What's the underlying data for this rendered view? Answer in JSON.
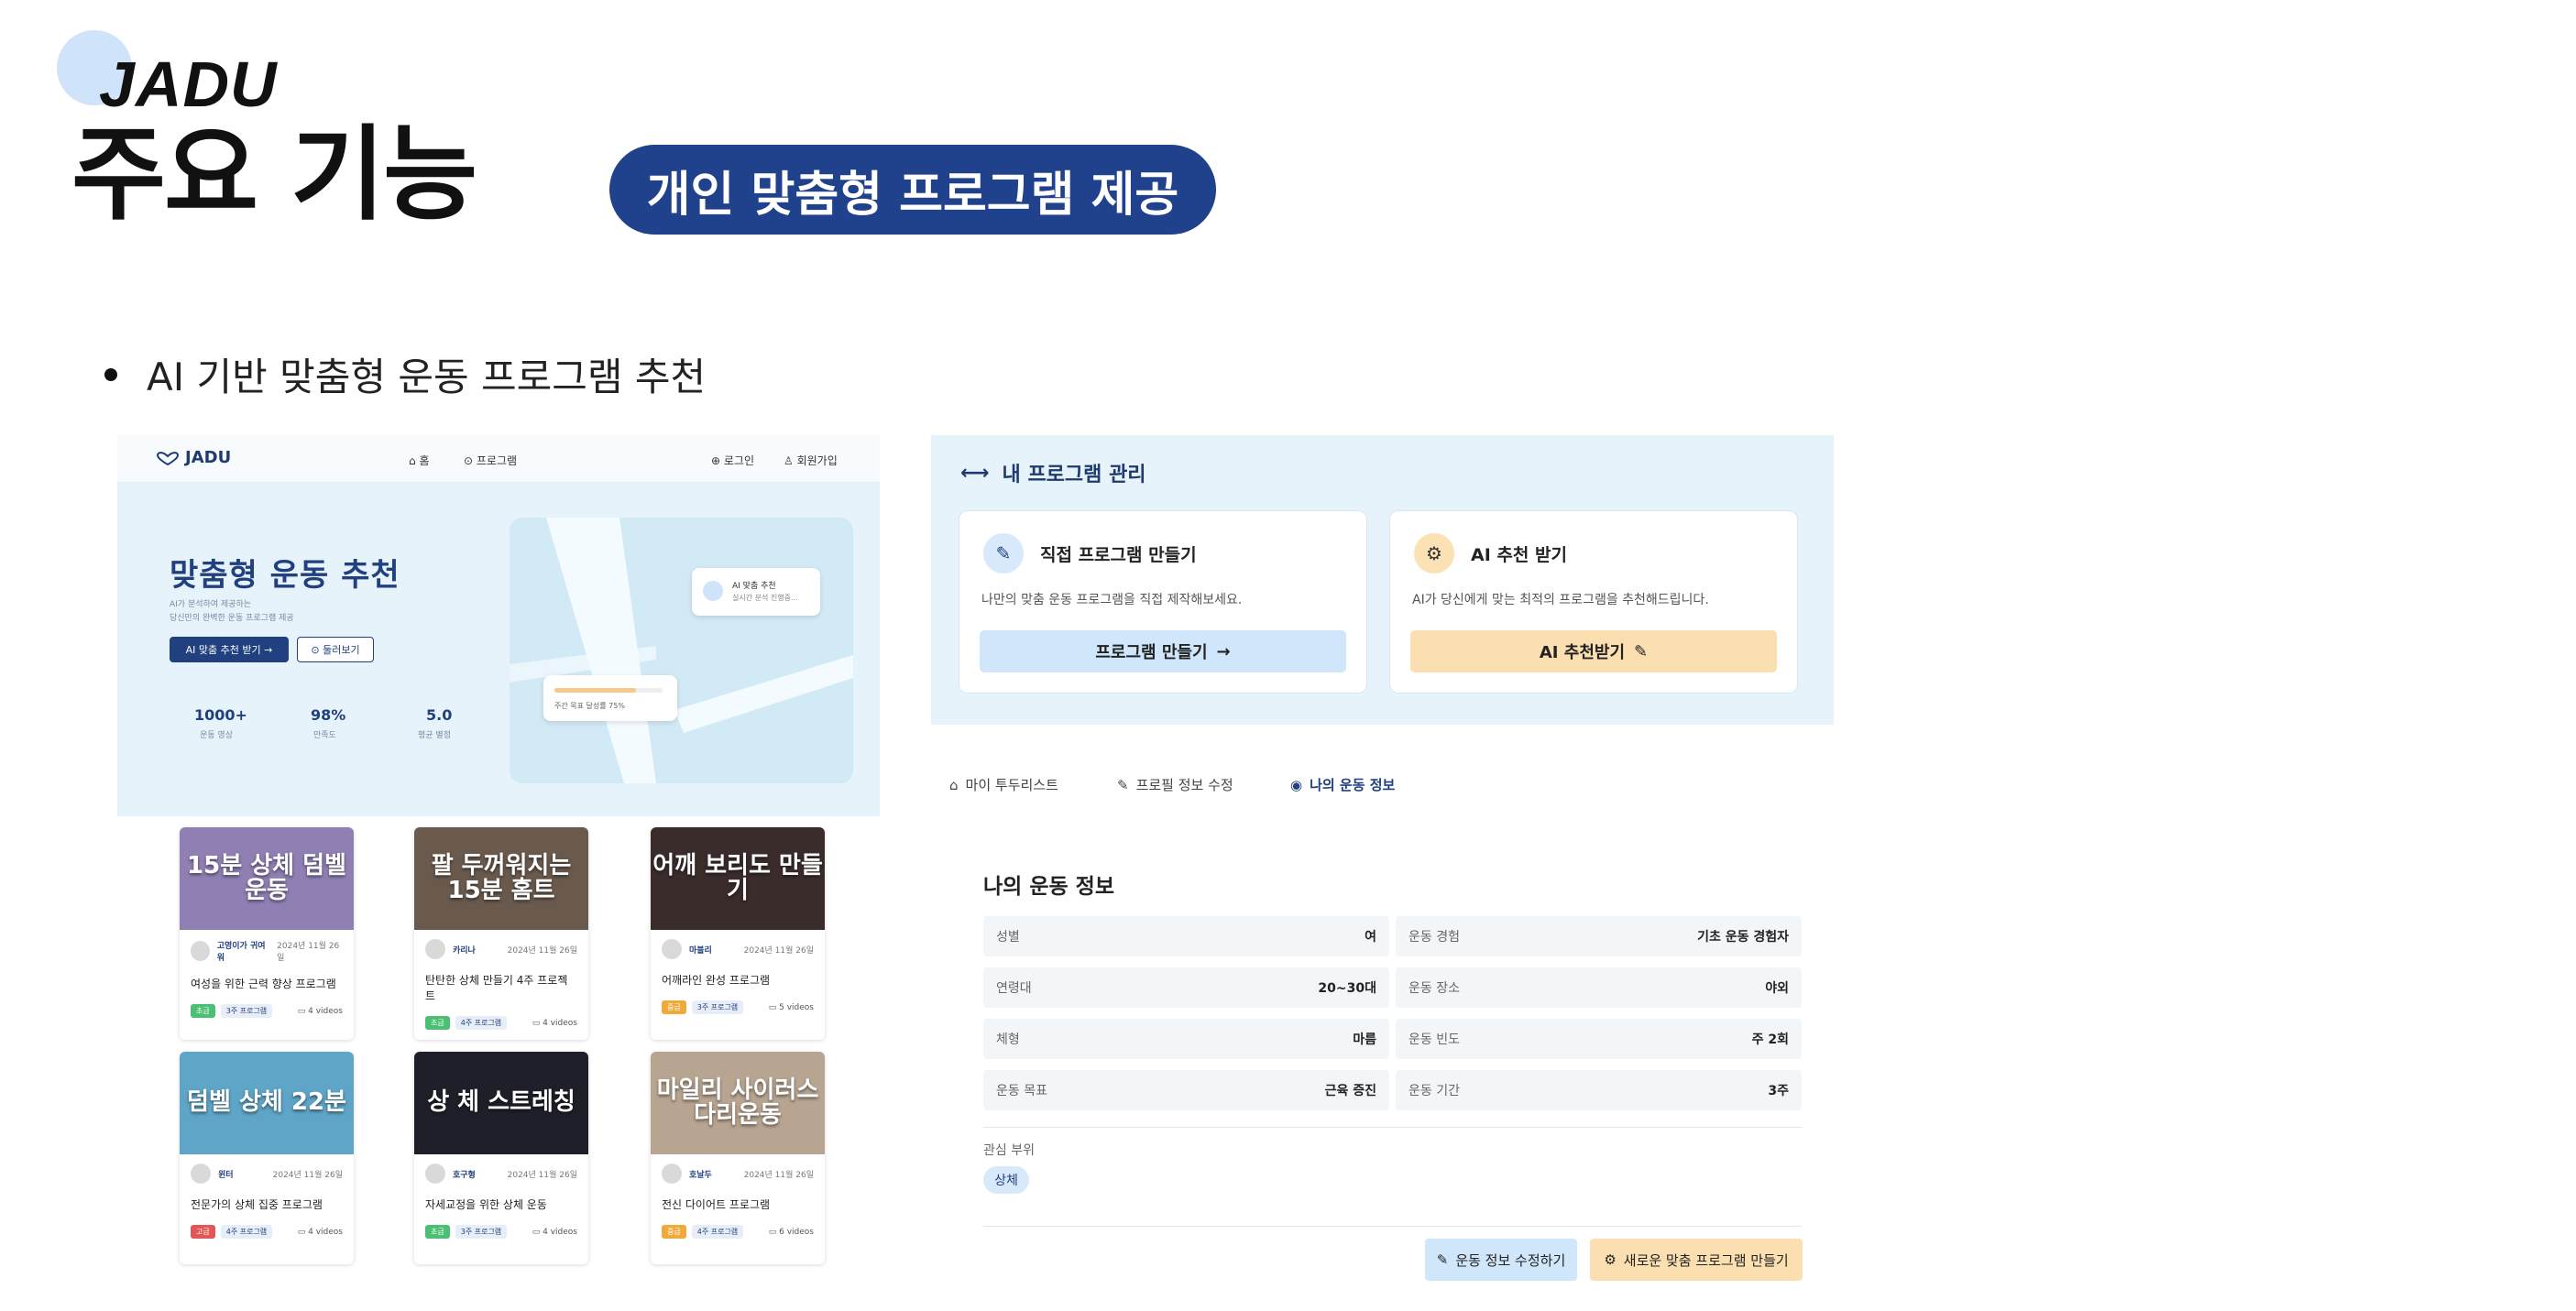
{
  "header": {
    "brand": "JADU",
    "title": "주요 기능",
    "pill": "개인 맞춤형 프로그램 제공",
    "bullet": "AI 기반 맞춤형 운동 프로그램 추천"
  },
  "left_shot": {
    "nav": {
      "logo": "JADU",
      "home": "홈",
      "program": "프로그램",
      "login": "로그인",
      "signup": "회원가입"
    },
    "hero": {
      "title": "맞춤형 운동 추천",
      "sub1": "AI가 분석하여 제공하는",
      "sub2": "당신만의 완벽한 운동 프로그램 제공",
      "btn_ai": "AI 맞춤 추천 받기 →",
      "btn_more": "둘러보기"
    },
    "stats": [
      {
        "value": "1000+",
        "label": "운동 영상"
      },
      {
        "value": "98%",
        "label": "만족도"
      },
      {
        "value": "5.0",
        "label": "평균 별점"
      }
    ],
    "map_cards": {
      "title": "AI 맞춤 추천",
      "sub": "실시간 분석 진행중...",
      "goal": "주간 목표 달성률 75%",
      "goal_progress": 0.75
    },
    "cards": [
      {
        "thumb": "15분 상체 덤벨 운동",
        "author": "고영이가 귀여워",
        "date": "2024년 11월 26일",
        "title": "여성을 위한 근력 향상 프로그램",
        "tag": "초급",
        "tag_color": "g",
        "weeks": "3주 프로그램",
        "videos": "4 videos",
        "bg": "#8f7fb3"
      },
      {
        "thumb": "팔 두꺼워지는 15분 홈트",
        "author": "카리나",
        "date": "2024년 11월 26일",
        "title": "탄탄한 상체 만들기 4주 프로젝트",
        "tag": "초급",
        "tag_color": "g",
        "weeks": "4주 프로그램",
        "videos": "4 videos",
        "bg": "#6a5a4e"
      },
      {
        "thumb": "어깨 보리도 만들기",
        "author": "마블리",
        "date": "2024년 11월 26일",
        "title": "어깨라인 완성 프로그램",
        "tag": "중급",
        "tag_color": "o",
        "weeks": "3주 프로그램",
        "videos": "5 videos",
        "bg": "#3b2c2c"
      },
      {
        "thumb": "덤벨 상체 22분",
        "author": "윈터",
        "date": "2024년 11월 26일",
        "title": "전문가의 상체 집중 프로그램",
        "tag": "고급",
        "tag_color": "r",
        "weeks": "4주 프로그램",
        "videos": "4 videos",
        "bg": "#5fa5c7"
      },
      {
        "thumb": "상 체 스트레칭",
        "author": "호구형",
        "date": "2024년 11월 26일",
        "title": "자세교정을 위한 상체 운동",
        "tag": "초급",
        "tag_color": "g",
        "weeks": "3주 프로그램",
        "videos": "4 videos",
        "bg": "#1f1f2a"
      },
      {
        "thumb": "마일리 사이러스 다리운동",
        "author": "호날두",
        "date": "2024년 11월 26일",
        "title": "전신 다이어트 프로그램",
        "tag": "중급",
        "tag_color": "o",
        "weeks": "4주 프로그램",
        "videos": "6 videos",
        "bg": "#b8a591"
      }
    ]
  },
  "right_shot": {
    "panel_title": "내 프로그램 관리",
    "direct": {
      "title": "직접 프로그램 만들기",
      "desc": "나만의 맞춤 운동 프로그램을 직접 제작해보세요.",
      "btn": "프로그램 만들기"
    },
    "ai": {
      "title": "AI 추천 받기",
      "desc": "AI가 당신에게 맞는 최적의 프로그램을 추천해드립니다.",
      "btn": "AI 추천받기"
    },
    "tabs": [
      "마이 투두리스트",
      "프로필 정보 수정",
      "나의 운동 정보"
    ],
    "section_title": "나의 운동 정보",
    "info_left": [
      {
        "k": "성별",
        "v": "여"
      },
      {
        "k": "연령대",
        "v": "20~30대"
      },
      {
        "k": "체형",
        "v": "마름"
      },
      {
        "k": "운동 목표",
        "v": "근육 증진"
      }
    ],
    "info_right": [
      {
        "k": "운동 경험",
        "v": "기초 운동 경험자"
      },
      {
        "k": "운동 장소",
        "v": "야외"
      },
      {
        "k": "운동 빈도",
        "v": "주 2회"
      },
      {
        "k": "운동 기간",
        "v": "3주"
      }
    ],
    "interest_label": "관심 부위",
    "interest_chip": "상체",
    "btn_edit": "운동 정보 수정하기",
    "btn_new": "새로운 맞춤 프로그램 만들기"
  },
  "colors": {
    "navy": "#20418b",
    "light_blue": "#e6f3fb",
    "btn_blue": "#cfe6fb",
    "btn_peach": "#fbdfb0"
  }
}
